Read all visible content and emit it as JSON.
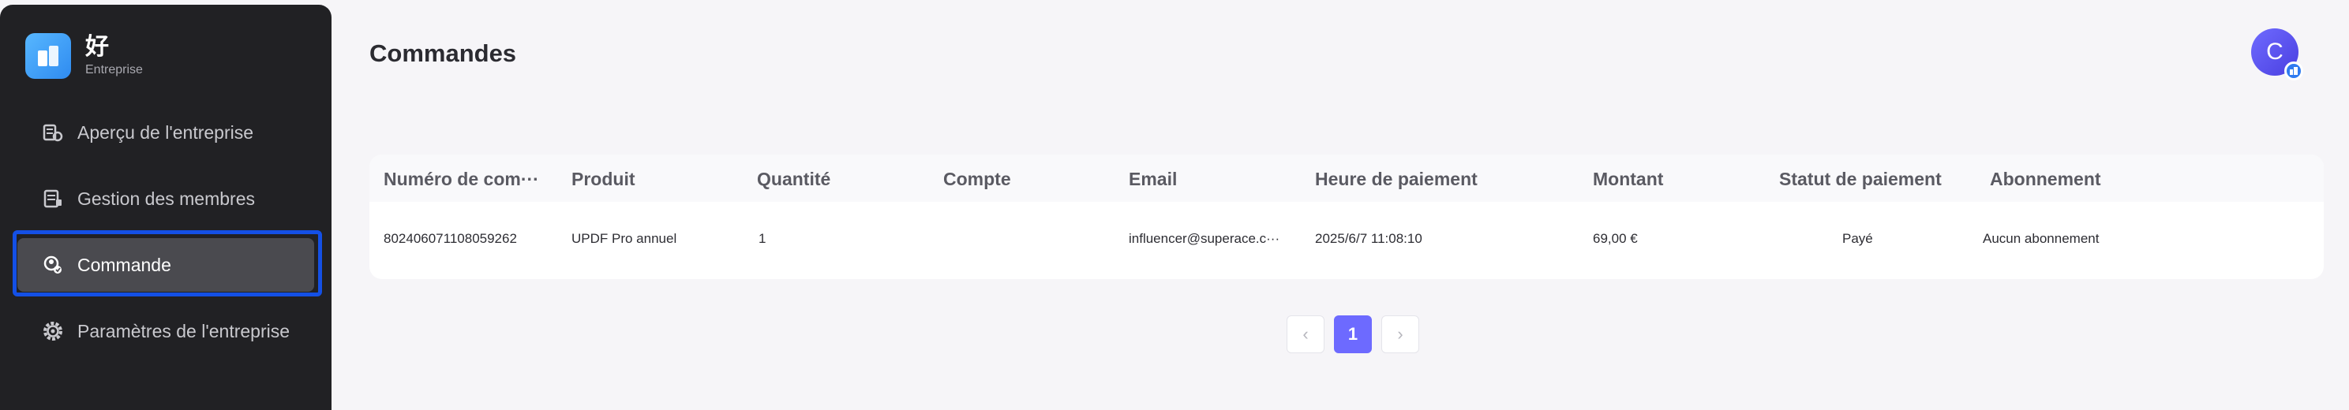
{
  "brand": {
    "name": "好",
    "subtitle": "Entreprise"
  },
  "sidebar": {
    "items": [
      {
        "label": "Aperçu de l'entreprise",
        "icon": "building-chart-icon"
      },
      {
        "label": "Gestion des membres",
        "icon": "members-icon"
      },
      {
        "label": "Commande",
        "icon": "order-search-icon",
        "active": true
      },
      {
        "label": "Paramètres de l'entreprise",
        "icon": "gear-icon"
      }
    ]
  },
  "header": {
    "title": "Commandes",
    "avatar_initial": "C"
  },
  "table": {
    "columns": [
      "Numéro de com···",
      "Produit",
      "Quantité",
      "Compte",
      "Email",
      "Heure de paiement",
      "Montant",
      "Statut de paiement",
      "Abonnement"
    ],
    "rows": [
      [
        "802406071108059262",
        "UPDF Pro annuel",
        "1",
        "",
        "influencer@superace.c···",
        "2025/6/7 11:08:10",
        "69,00 €",
        "Payé",
        "Aucun abonnement"
      ]
    ]
  },
  "pagination": {
    "prev": "‹",
    "current": "1",
    "next": "›"
  },
  "colors": {
    "accent": "#6d6aff",
    "focus": "#1450e6",
    "sidebar": "#212124"
  }
}
